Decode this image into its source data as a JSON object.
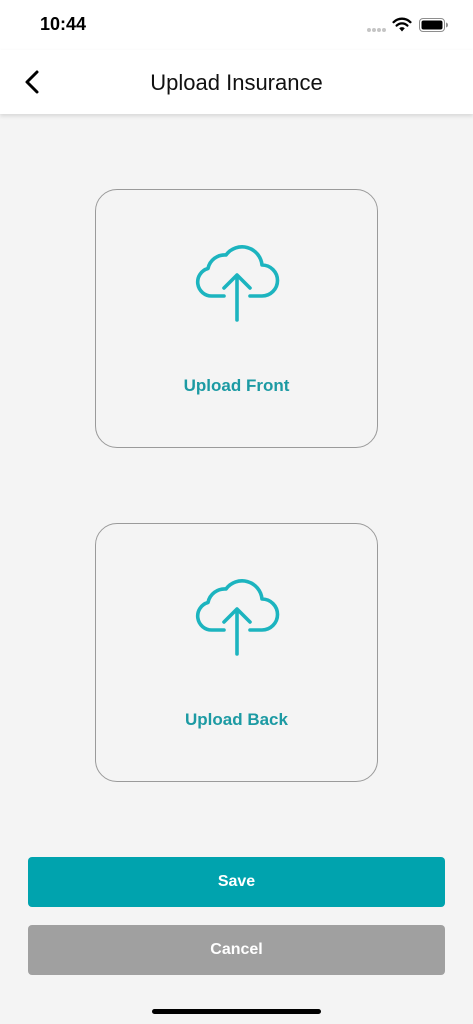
{
  "status_bar": {
    "time": "10:44",
    "icons": [
      "cellular-signal-icon",
      "wifi-icon",
      "battery-icon"
    ]
  },
  "header": {
    "title": "Upload Insurance",
    "back_icon": "chevron-left-icon"
  },
  "upload_front": {
    "label": "Upload Front",
    "icon": "cloud-upload-icon"
  },
  "upload_back": {
    "label": "Upload Back",
    "icon": "cloud-upload-icon"
  },
  "actions": {
    "save_label": "Save",
    "cancel_label": "Cancel"
  },
  "colors": {
    "accent": "#1c9aa3",
    "save_button": "#00a3ae",
    "cancel_button": "#a0a0a0",
    "background": "#f4f4f4"
  }
}
